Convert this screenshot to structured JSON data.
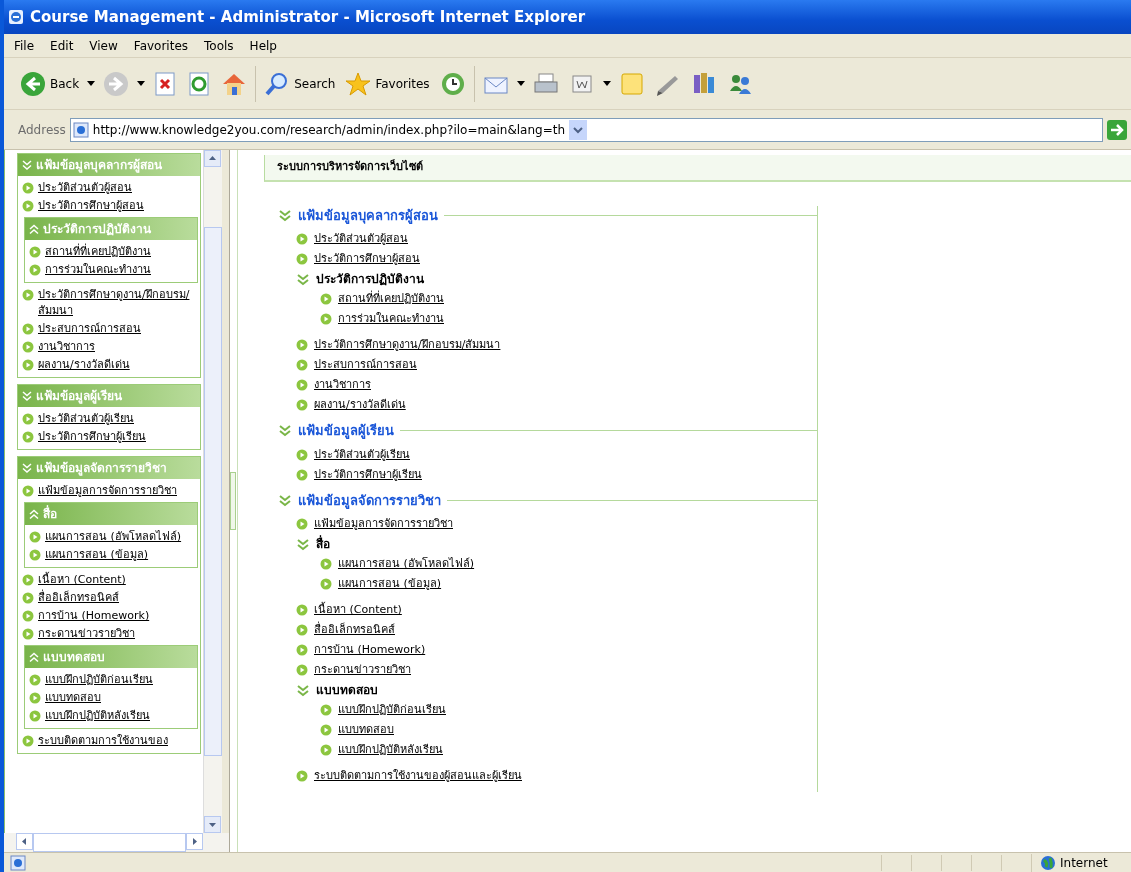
{
  "window": {
    "title": "Course Management - Administrator - Microsoft Internet Explorer"
  },
  "menu_bar": [
    "File",
    "Edit",
    "View",
    "Favorites",
    "Tools",
    "Help"
  ],
  "toolbar": [
    {
      "kind": "back",
      "label": "Back"
    },
    {
      "kind": "forward"
    },
    {
      "kind": "stop"
    },
    {
      "kind": "refresh"
    },
    {
      "kind": "home"
    },
    {
      "kind": "search",
      "label": "Search"
    },
    {
      "kind": "favorites",
      "label": "Favorites"
    },
    {
      "kind": "history"
    },
    {
      "kind": "mail"
    },
    {
      "kind": "print"
    },
    {
      "kind": "edit"
    },
    {
      "kind": "note"
    },
    {
      "kind": "research"
    },
    {
      "kind": "books"
    },
    {
      "kind": "messenger"
    }
  ],
  "address_bar": {
    "label": "Address",
    "value": "http://www.knowledge2you.com/research/admin/index.php?ilo=main&lang=th"
  },
  "sidebar": {
    "sections": [
      {
        "title": "แฟ้มข้อมูลบุคลากรผู้สอน",
        "items": [
          {
            "kind": "link",
            "label": "ประวัติส่วนตัวผู้สอน"
          },
          {
            "kind": "link",
            "label": "ประวัติการศึกษาผู้สอน"
          },
          {
            "kind": "group",
            "label": "ประวัติการปฏิบัติงาน",
            "children": [
              {
                "kind": "link",
                "label": "สถานที่ที่เคยปฏิบัติงาน"
              },
              {
                "kind": "link",
                "label": "การร่วมในคณะทำงาน"
              }
            ]
          },
          {
            "kind": "link",
            "label": "ประวัติการศึกษาดูงาน/ฝึกอบรม/สัมมนา"
          },
          {
            "kind": "link",
            "label": "ประสบการณ์การสอน"
          },
          {
            "kind": "link",
            "label": "งานวิชาการ"
          },
          {
            "kind": "link",
            "label": "ผลงาน/รางวัลดีเด่น"
          }
        ]
      },
      {
        "title": "แฟ้มข้อมูลผู้เรียน",
        "items": [
          {
            "kind": "link",
            "label": "ประวัติส่วนตัวผู้เรียน"
          },
          {
            "kind": "link",
            "label": "ประวัติการศึกษาผู้เรียน"
          }
        ]
      },
      {
        "title": "แฟ้มข้อมูลจัดการรายวิชา",
        "items": [
          {
            "kind": "link",
            "label": "แฟ้มข้อมูลการจัดการรายวิชา"
          },
          {
            "kind": "group",
            "label": "สื่อ",
            "children": [
              {
                "kind": "link",
                "label": "แผนการสอน (อัพโหลดไฟล์)"
              },
              {
                "kind": "link",
                "label": "แผนการสอน (ข้อมูล)"
              }
            ]
          },
          {
            "kind": "link",
            "label": "เนื้อหา (Content)"
          },
          {
            "kind": "link",
            "label": "สื่ออิเล็กทรอนิคส์"
          },
          {
            "kind": "link",
            "label": "การบ้าน (Homework)"
          },
          {
            "kind": "link",
            "label": "กระดานข่าวรายวิชา"
          },
          {
            "kind": "group",
            "label": "แบบทดสอบ",
            "children": [
              {
                "kind": "link",
                "label": "แบบฝึกปฏิบัติก่อนเรียน"
              },
              {
                "kind": "link",
                "label": "แบบทดสอบ"
              },
              {
                "kind": "link",
                "label": "แบบฝึกปฏิบัติหลังเรียน"
              }
            ]
          },
          {
            "kind": "link",
            "label": "ระบบติดตามการใช้งานของ"
          }
        ]
      }
    ]
  },
  "main": {
    "header": "ระบบการบริหารจัดการเว็บไซต์",
    "sections": [
      {
        "title": "แฟ้มข้อมูลบุคลากรผู้สอน",
        "items": [
          {
            "kind": "link",
            "label": "ประวัติส่วนตัวผู้สอน"
          },
          {
            "kind": "link",
            "label": "ประวัติการศึกษาผู้สอน"
          },
          {
            "kind": "group",
            "label": "ประวัติการปฏิบัติงาน",
            "children": [
              {
                "kind": "link",
                "label": "สถานที่ที่เคยปฏิบัติงาน"
              },
              {
                "kind": "link",
                "label": "การร่วมในคณะทำงาน"
              }
            ]
          },
          {
            "kind": "link",
            "label": "ประวัติการศึกษาดูงาน/ฝึกอบรม/สัมมนา"
          },
          {
            "kind": "link",
            "label": "ประสบการณ์การสอน"
          },
          {
            "kind": "link",
            "label": "งานวิชาการ"
          },
          {
            "kind": "link",
            "label": "ผลงาน/รางวัลดีเด่น"
          }
        ]
      },
      {
        "title": "แฟ้มข้อมูลผู้เรียน",
        "items": [
          {
            "kind": "link",
            "label": "ประวัติส่วนตัวผู้เรียน"
          },
          {
            "kind": "link",
            "label": "ประวัติการศึกษาผู้เรียน"
          }
        ]
      },
      {
        "title": "แฟ้มข้อมูลจัดการรายวิชา",
        "items": [
          {
            "kind": "link",
            "label": "แฟ้มข้อมูลการจัดการรายวิชา"
          },
          {
            "kind": "group",
            "label": "สื่อ",
            "children": [
              {
                "kind": "link",
                "label": "แผนการสอน (อัพโหลดไฟล์)"
              },
              {
                "kind": "link",
                "label": "แผนการสอน (ข้อมูล)"
              }
            ]
          },
          {
            "kind": "link",
            "label": "เนื้อหา (Content)"
          },
          {
            "kind": "link",
            "label": "สื่ออิเล็กทรอนิคส์"
          },
          {
            "kind": "link",
            "label": "การบ้าน (Homework)"
          },
          {
            "kind": "link",
            "label": "กระดานข่าวรายวิชา"
          },
          {
            "kind": "group",
            "label": "แบบทดสอบ",
            "children": [
              {
                "kind": "link",
                "label": "แบบฝึกปฏิบัติก่อนเรียน"
              },
              {
                "kind": "link",
                "label": "แบบทดสอบ"
              },
              {
                "kind": "link",
                "label": "แบบฝึกปฏิบัติหลังเรียน"
              }
            ]
          },
          {
            "kind": "link",
            "label": "ระบบติดตามการใช้งานของผู้สอนและผู้เรียน"
          }
        ]
      }
    ]
  },
  "status_bar": {
    "zone": "Internet"
  }
}
